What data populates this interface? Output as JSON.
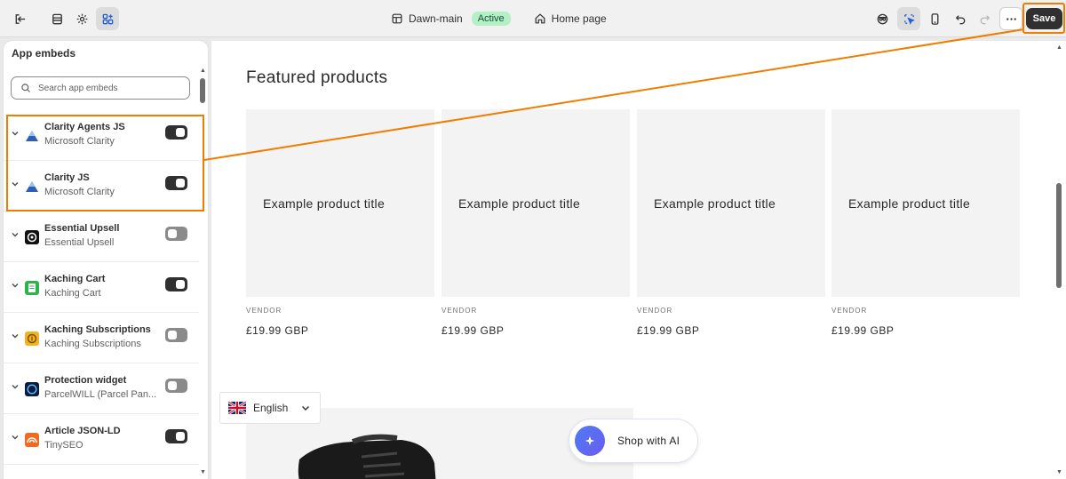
{
  "topbar": {
    "theme_name": "Dawn-main",
    "theme_status": "Active",
    "page_name": "Home page",
    "save_label": "Save"
  },
  "sidebar": {
    "title": "App embeds",
    "search_placeholder": "Search app embeds",
    "embeds": [
      {
        "name": "Clarity Agents JS",
        "provider": "Microsoft Clarity",
        "enabled": true,
        "icon": "clarity-icon"
      },
      {
        "name": "Clarity JS",
        "provider": "Microsoft Clarity",
        "enabled": true,
        "icon": "clarity-icon"
      },
      {
        "name": "Essential Upsell",
        "provider": "Essential Upsell",
        "enabled": false,
        "icon": "essential-upsell-icon"
      },
      {
        "name": "Kaching Cart",
        "provider": "Kaching Cart",
        "enabled": true,
        "icon": "kaching-cart-icon"
      },
      {
        "name": "Kaching Subscriptions",
        "provider": "Kaching Subscriptions",
        "enabled": false,
        "icon": "kaching-subscriptions-icon"
      },
      {
        "name": "Protection widget",
        "provider": "ParcelWILL (Parcel Pan...",
        "enabled": false,
        "icon": "parcelwill-icon"
      },
      {
        "name": "Article JSON-LD",
        "provider": "TinySEO",
        "enabled": true,
        "icon": "tinyseo-icon"
      }
    ]
  },
  "preview": {
    "section_title": "Featured products",
    "products": [
      {
        "title": "Example product title",
        "vendor": "VENDOR",
        "price": "£19.99 GBP"
      },
      {
        "title": "Example product title",
        "vendor": "VENDOR",
        "price": "£19.99 GBP"
      },
      {
        "title": "Example product title",
        "vendor": "VENDOR",
        "price": "£19.99 GBP"
      },
      {
        "title": "Example product title",
        "vendor": "VENDOR",
        "price": "£19.99 GBP"
      }
    ],
    "language": "English",
    "ai_button": "Shop with AI"
  },
  "colors": {
    "highlight": "#f07d00",
    "active_badge_bg": "#b4f0c6",
    "save_bg": "#303030"
  }
}
